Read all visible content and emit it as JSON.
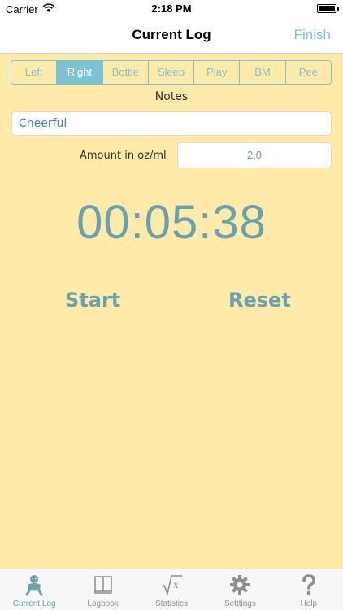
{
  "status_bar": {
    "carrier": "Carrier",
    "time": "2:18 PM"
  },
  "nav": {
    "title": "Current Log",
    "finish_label": "Finish"
  },
  "segments": [
    {
      "label": "Left",
      "selected": false
    },
    {
      "label": "Right",
      "selected": true
    },
    {
      "label": "Bottle",
      "selected": false
    },
    {
      "label": "Sleep",
      "selected": false
    },
    {
      "label": "Play",
      "selected": false
    },
    {
      "label": "BM",
      "selected": false
    },
    {
      "label": "Pee",
      "selected": false
    }
  ],
  "notes": {
    "label": "Notes",
    "value": "Cheerful"
  },
  "amount": {
    "label": "Amount in oz/ml",
    "value": "2.0"
  },
  "timer": {
    "display": "00:05:38",
    "start_label": "Start",
    "reset_label": "Reset"
  },
  "tabs": [
    {
      "label": "Current Log",
      "icon": "baby-icon",
      "active": true
    },
    {
      "label": "Logbook",
      "icon": "book-icon",
      "active": false
    },
    {
      "label": "Statistics",
      "icon": "sqrt-x-icon",
      "active": false
    },
    {
      "label": "Setttings",
      "icon": "gear-icon",
      "active": false
    },
    {
      "label": "Help",
      "icon": "question-mark-icon",
      "active": false
    }
  ],
  "colors": {
    "background": "#ffeaa9",
    "accent": "#7bc3d1",
    "timer_text": "#6aa1b0"
  }
}
